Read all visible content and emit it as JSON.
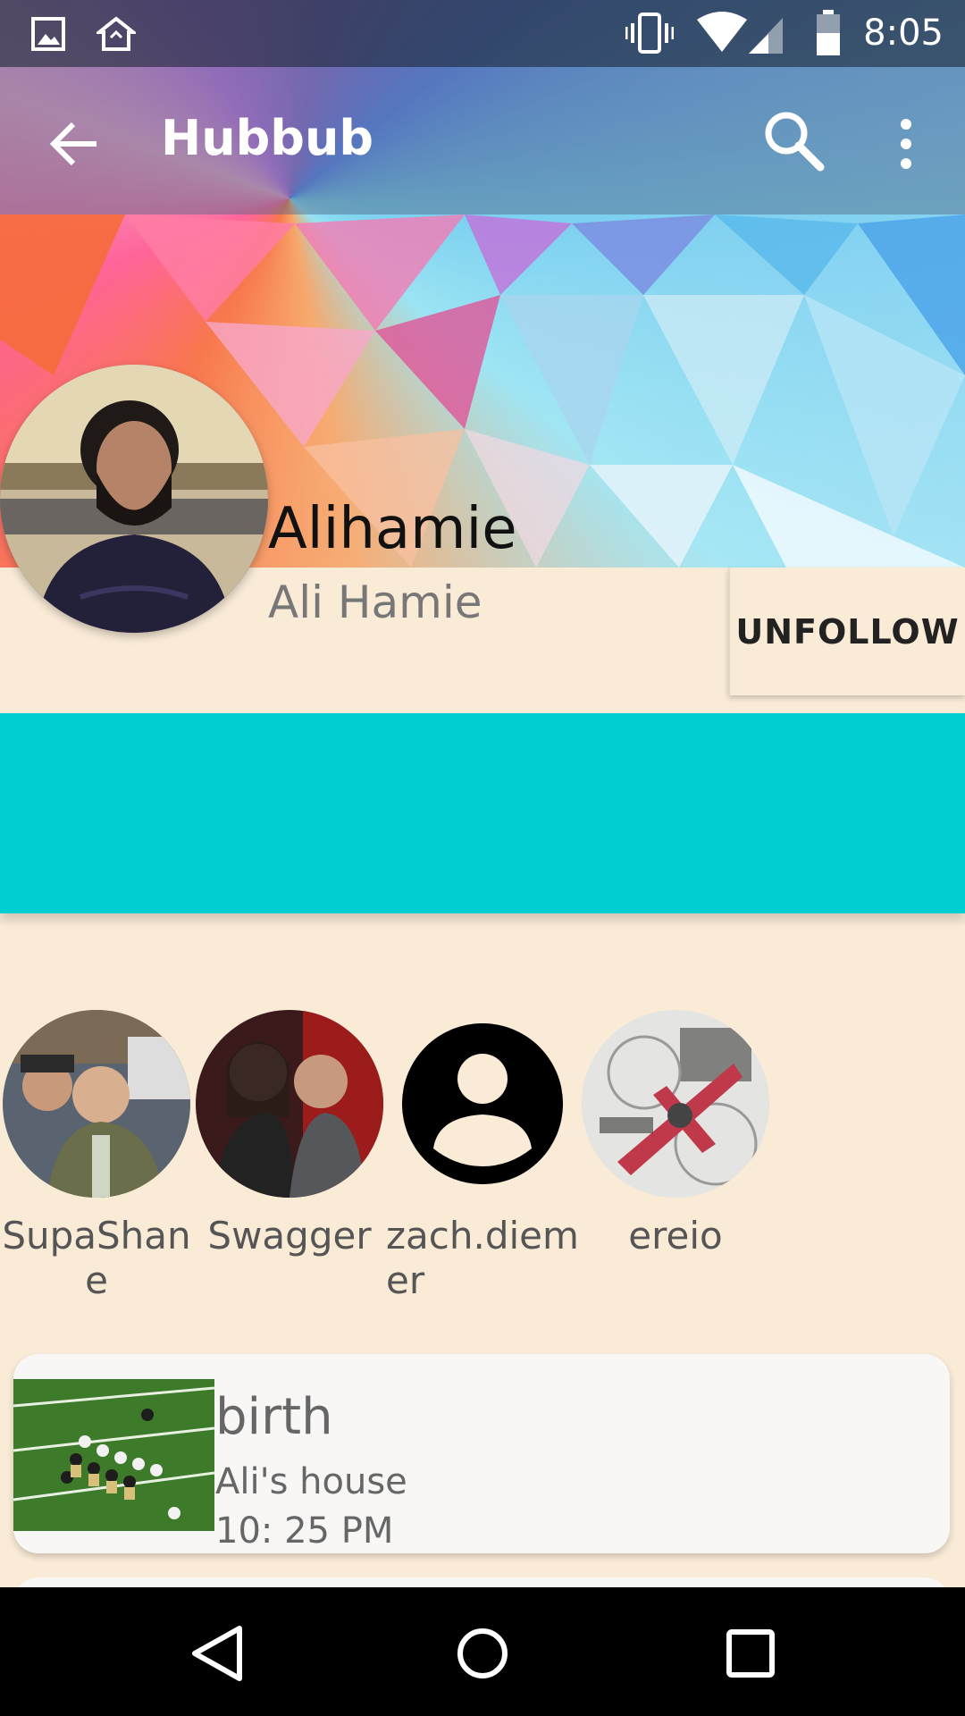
{
  "app": {
    "title": "Hubbub"
  },
  "status_bar": {
    "time": "8:05"
  },
  "icons": {
    "back": "arrow-back-icon",
    "search": "search-icon",
    "more": "more-vert-icon",
    "gallery": "gallery-icon",
    "home_notif": "home-notification-icon",
    "vibrate": "vibrate-icon",
    "wifi": "wifi-icon",
    "signal": "signal-icon",
    "battery": "battery-icon"
  },
  "profile": {
    "username": "Alihamie",
    "full_name": "Ali Hamie",
    "action_label": "UNFOLLOW"
  },
  "colors": {
    "background": "#faebd7",
    "accent_band": "#00ced1"
  },
  "following": [
    {
      "name": "SupaShane"
    },
    {
      "name": "Swagger"
    },
    {
      "name": "zach.diemer"
    },
    {
      "name": "ereio"
    }
  ],
  "events": [
    {
      "title": "birth",
      "location": "Ali's house",
      "time": "10: 25 PM"
    }
  ]
}
